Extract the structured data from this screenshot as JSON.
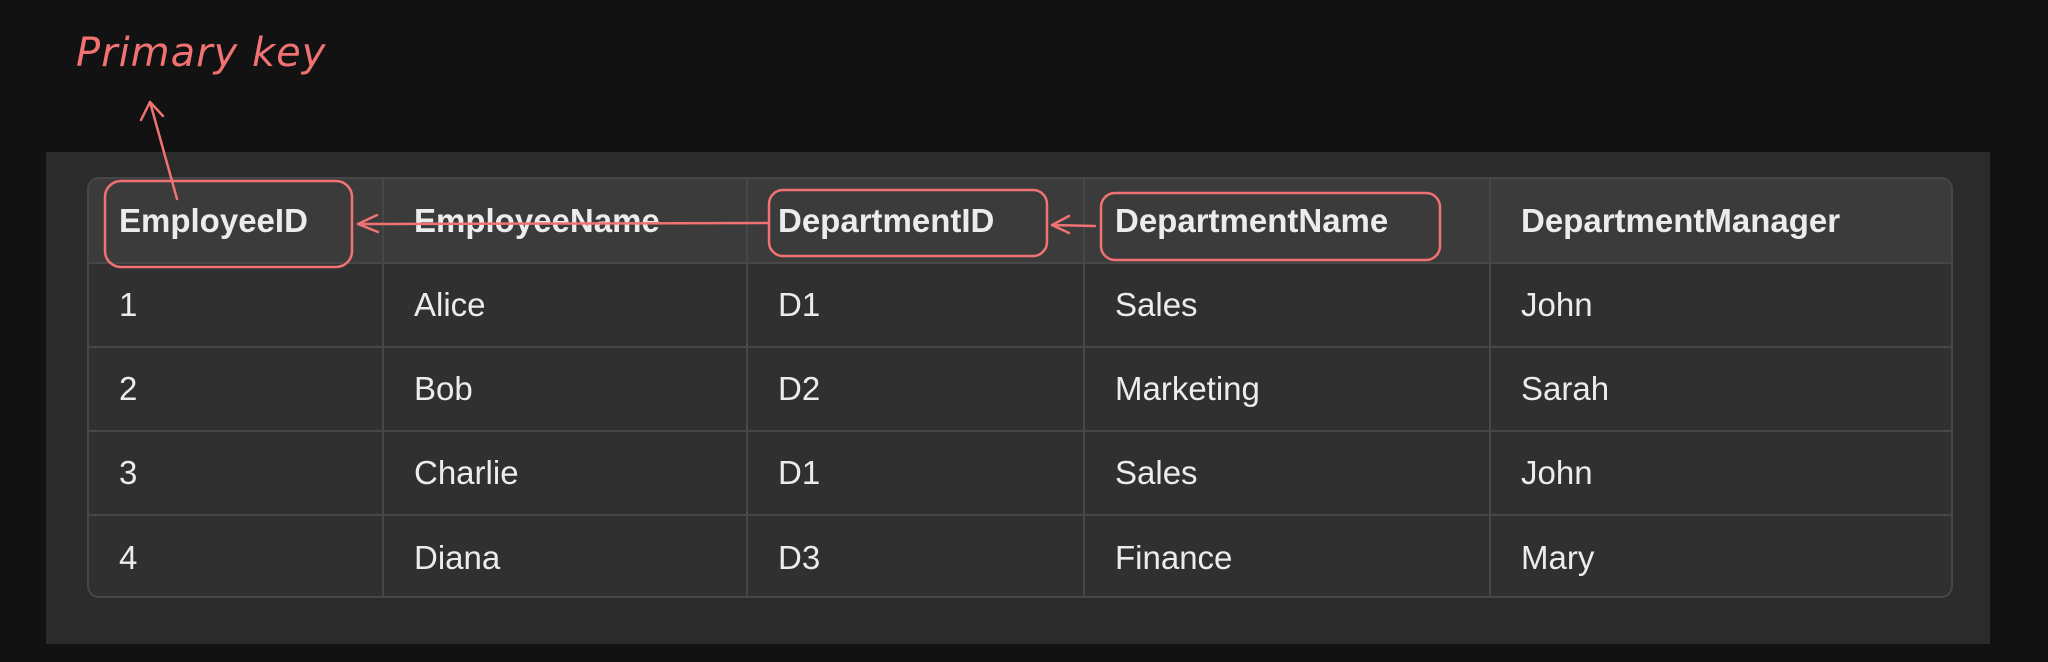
{
  "annotation": {
    "label": "Primary key",
    "color": "#f07272"
  },
  "table": {
    "headers": [
      "EmployeeID",
      "EmployeeName",
      "DepartmentID",
      "DepartmentName",
      "DepartmentManager"
    ],
    "rows": [
      [
        "1",
        "Alice",
        "D1",
        "Sales",
        "John"
      ],
      [
        "2",
        "Bob",
        "D2",
        "Marketing",
        "Sarah"
      ],
      [
        "3",
        "Charlie",
        "D1",
        "Sales",
        "John"
      ],
      [
        "4",
        "Diana",
        "D3",
        "Finance",
        "Mary"
      ]
    ]
  },
  "colors": {
    "background": "#121212",
    "panel": "#2b2b2b",
    "header_row": "#3b3b3b",
    "grid": "#474747",
    "text": "#ececec",
    "annotation": "#f07272"
  }
}
